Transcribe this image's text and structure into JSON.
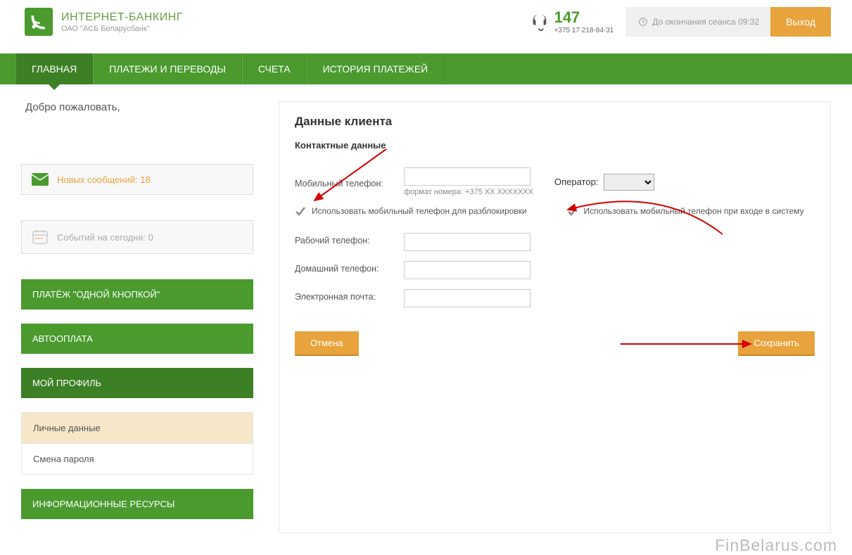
{
  "header": {
    "brand_title": "ИНТЕРНЕТ-БАНКИНГ",
    "brand_sub": "ОАО \"АСБ Беларусбанк\"",
    "support_num": "147",
    "support_phone": "+375 17 218-84-31",
    "session_text": "До окончания сеанса 09:32",
    "logout": "Выход"
  },
  "nav": {
    "items": [
      "ГЛАВНАЯ",
      "ПЛАТЕЖИ И ПЕРЕВОДЫ",
      "СЧЕТА",
      "ИСТОРИЯ ПЛАТЕЖЕЙ"
    ],
    "active_index": 0
  },
  "sidebar": {
    "welcome": "Добро пожаловать,",
    "messages_label": "Новых сообщений: 18",
    "events_label": "Событий на сегодня: 0",
    "one_click": "ПЛАТЁЖ \"ОДНОЙ КНОПКОЙ\"",
    "autopay": "АВТООПЛАТА",
    "profile": "МОЙ ПРОФИЛЬ",
    "profile_items": [
      "Личные данные",
      "Смена пароля"
    ],
    "info_res": "ИНФОРМАЦИОННЫЕ РЕСУРСЫ"
  },
  "main": {
    "title": "Данные клиента",
    "subtitle": "Контактные данные",
    "mobile_label": "Мобильный телефон:",
    "mobile_hint": "формат номера: +375 XX XXXXXXX",
    "operator_label": "Оператор:",
    "check_unblock": "Использовать мобильный телефон для разблокировки",
    "check_login": "Использовать мобильный телефон при входе в систему",
    "work_label": "Рабочий телефон:",
    "home_label": "Домашний телефон:",
    "email_label": "Электронная почта:",
    "cancel": "Отмена",
    "save": "Сохранить"
  },
  "watermark": "FinBelarus.com"
}
